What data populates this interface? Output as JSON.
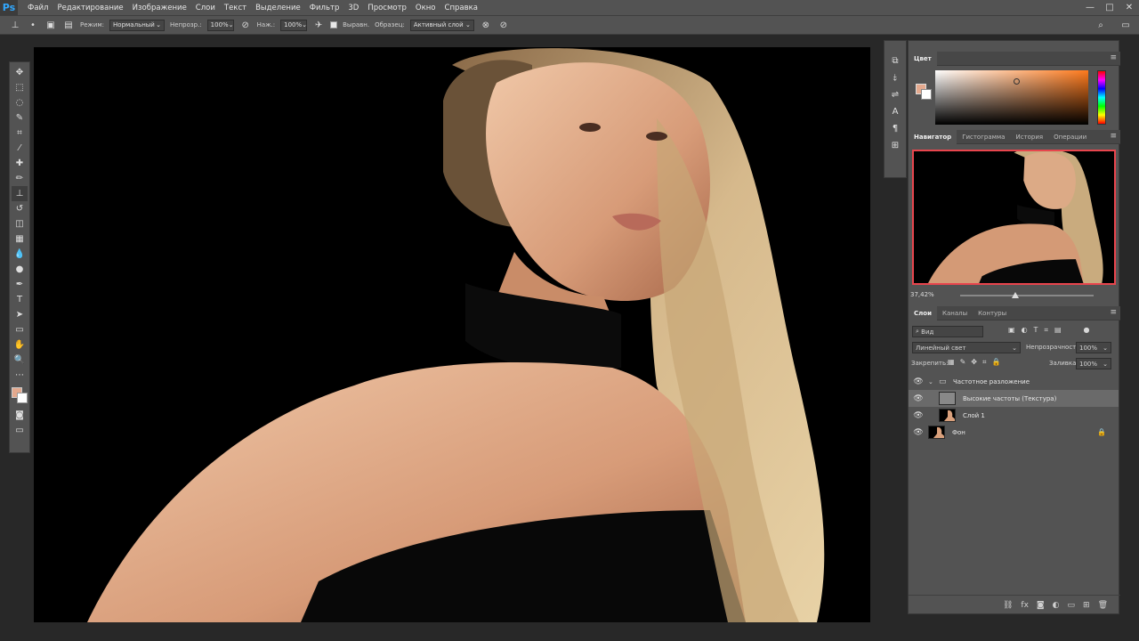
{
  "app": {
    "logo": "Ps"
  },
  "menu": [
    "Файл",
    "Редактирование",
    "Изображение",
    "Слои",
    "Текст",
    "Выделение",
    "Фильтр",
    "3D",
    "Просмотр",
    "Окно",
    "Справка"
  ],
  "window_controls": {
    "minimize": "—",
    "maximize": "□",
    "close": "✕"
  },
  "options": {
    "mode_label": "Режим:",
    "mode_value": "Нормальный",
    "opacity_label": "Непрозр.:",
    "opacity_value": "100%",
    "pressure_label": "Наж.:",
    "pressure_value": "100%",
    "aligned_label": "Выравн.",
    "sample_label": "Образец:",
    "sample_value": "Активный слой"
  },
  "colors": {
    "foreground": "#e4a98e",
    "background": "#ffffff",
    "navigator_frame": "#e8454d"
  },
  "color_panel": {
    "tab": "Цвет"
  },
  "navigator": {
    "tabs": [
      "Навигатор",
      "Гистограмма",
      "История",
      "Операции"
    ],
    "zoom": "37,42%"
  },
  "layers": {
    "tabs": [
      "Слои",
      "Каналы",
      "Контуры"
    ],
    "filter_label": "Вид",
    "blend_mode": "Линейный свет",
    "opacity_label": "Непрозрачность:",
    "opacity_value": "100%",
    "lock_label": "Закрепить:",
    "fill_label": "Заливка:",
    "fill_value": "100%",
    "items": [
      {
        "name": "Частотное разложение",
        "kind": "group"
      },
      {
        "name": "Высокие частоты (Текстура)",
        "kind": "layer",
        "selected": true
      },
      {
        "name": "Слой 1",
        "kind": "layer"
      },
      {
        "name": "Фон",
        "kind": "background",
        "locked": true
      }
    ]
  }
}
